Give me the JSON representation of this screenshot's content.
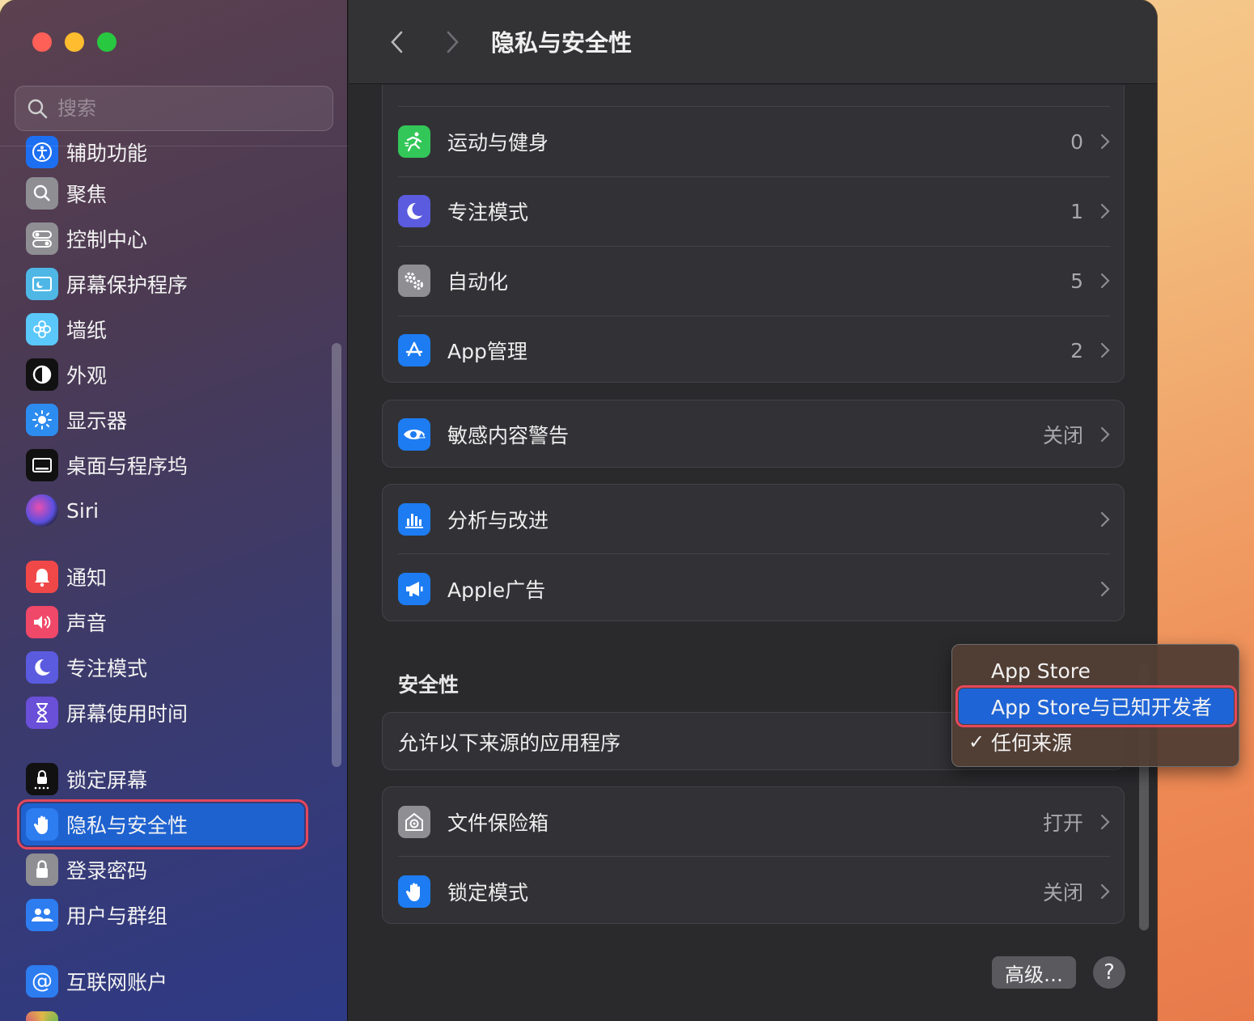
{
  "sidebar": {
    "search_placeholder": "搜索",
    "items": [
      {
        "label": "辅助功能",
        "icon": "accessibility-icon",
        "color": "#1d6ff2"
      },
      {
        "label": "聚焦",
        "icon": "spotlight-icon",
        "color": "#8e8e93"
      },
      {
        "label": "控制中心",
        "icon": "control-center-icon",
        "color": "#8e8e93"
      },
      {
        "label": "屏幕保护程序",
        "icon": "screensaver-icon",
        "color": "#4fb7e6"
      },
      {
        "label": "墙纸",
        "icon": "wallpaper-icon",
        "color": "#5ac8fa"
      },
      {
        "label": "外观",
        "icon": "appearance-icon",
        "color": "#111111"
      },
      {
        "label": "显示器",
        "icon": "display-icon",
        "color": "#2d8cf0"
      },
      {
        "label": "桌面与程序坞",
        "icon": "desktop-dock-icon",
        "color": "#111111"
      },
      {
        "label": "Siri",
        "icon": "siri-icon",
        "color": "#333333"
      },
      {
        "label": "通知",
        "icon": "notifications-icon",
        "color": "#f04848"
      },
      {
        "label": "声音",
        "icon": "sound-icon",
        "color": "#f04868"
      },
      {
        "label": "专注模式",
        "icon": "focus-icon",
        "color": "#5b5be0"
      },
      {
        "label": "屏幕使用时间",
        "icon": "screen-time-icon",
        "color": "#6a4fd8"
      },
      {
        "label": "锁定屏幕",
        "icon": "lock-screen-icon",
        "color": "#111111"
      },
      {
        "label": "隐私与安全性",
        "icon": "privacy-hand-icon",
        "color": "#2d7df0"
      },
      {
        "label": "登录密码",
        "icon": "login-password-icon",
        "color": "#8e8e93"
      },
      {
        "label": "用户与群组",
        "icon": "users-groups-icon",
        "color": "#2d7df0"
      },
      {
        "label": "互联网账户",
        "icon": "internet-accounts-icon",
        "color": "#2d7df0"
      }
    ],
    "selected": "隐私与安全性"
  },
  "toolbar": {
    "title": "隐私与安全性"
  },
  "privacy_group_a": [
    {
      "label": "运动与健身",
      "value": "0",
      "icon": "fitness-icon",
      "color": "#33c759"
    },
    {
      "label": "专注模式",
      "value": "1",
      "icon": "focus-moon-icon",
      "color": "#5b5be0"
    },
    {
      "label": "自动化",
      "value": "5",
      "icon": "automation-gear-icon",
      "color": "#8e8e93"
    },
    {
      "label": "App管理",
      "value": "2",
      "icon": "app-store-icon",
      "color": "#1d7cf2"
    }
  ],
  "privacy_group_b": [
    {
      "label": "敏感内容警告",
      "value": "关闭",
      "icon": "sensitive-eye-icon",
      "color": "#1d7cf2"
    }
  ],
  "privacy_group_c": [
    {
      "label": "分析与改进",
      "value": "",
      "icon": "analytics-icon",
      "color": "#1d7cf2"
    },
    {
      "label": "Apple广告",
      "value": "",
      "icon": "megaphone-icon",
      "color": "#1d7cf2"
    }
  ],
  "security": {
    "section_title": "安全性",
    "allow_apps_label": "允许以下来源的应用程序",
    "menu_options": [
      "App Store",
      "App Store与已知开发者",
      "任何来源"
    ],
    "highlighted_option": "App Store与已知开发者",
    "checked_option": "任何来源"
  },
  "security_group": [
    {
      "label": "文件保险箱",
      "value": "打开",
      "icon": "filevault-icon",
      "color": "#8e8e93"
    },
    {
      "label": "锁定模式",
      "value": "关闭",
      "icon": "lockdown-hand-icon",
      "color": "#1d7cf2"
    }
  ],
  "footer": {
    "advanced_label": "高级…",
    "help_label": "?"
  }
}
